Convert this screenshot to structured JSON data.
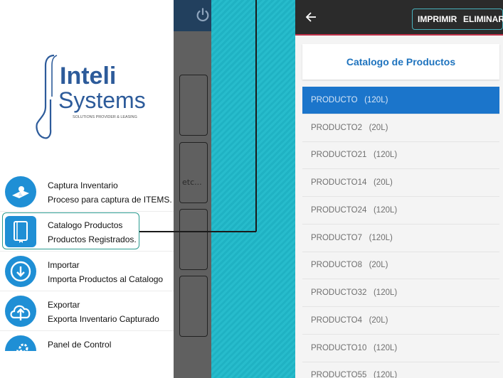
{
  "drawer": {
    "logo": {
      "brand_top": "Inteli",
      "brand_bottom": "Systems",
      "tagline": "SOLUTIONS PROVIDER & LEASING"
    },
    "menu": [
      {
        "title": "Captura Inventario",
        "subtitle": "Proceso para captura de ITEMS.",
        "icon": "inventory-capture-icon"
      },
      {
        "title": "Catalogo Productos",
        "subtitle": "Productos Registrados.",
        "icon": "catalog-book-icon"
      },
      {
        "title": "Importar",
        "subtitle": "Importa Productos al Catalogo",
        "icon": "download-icon"
      },
      {
        "title": "Exportar",
        "subtitle": "Exporta Inventario Capturado",
        "icon": "cloud-upload-icon"
      },
      {
        "title": "Panel de Control",
        "subtitle": "",
        "icon": "gears-icon"
      }
    ]
  },
  "behind": {
    "snippet": "etc..."
  },
  "catalog": {
    "actions": {
      "print": "IMPRIMIR",
      "delete": "ELIMINAR"
    },
    "title": "Catalogo de Productos",
    "products": [
      "PRODUCTO   (120L)",
      "PRODUCTO2   (20L)",
      "PRODUCTO21   (120L)",
      "PRODUCTO14   (20L)",
      "PRODUCTO24   (120L)",
      "PRODUCTO7   (120L)",
      "PRODUCTO8   (20L)",
      "PRODUCTO32   (120L)",
      "PRODUCTO4   (20L)",
      "PRODUCTO10   (120L)",
      "PRODUCTO55   (120L)"
    ]
  },
  "colors": {
    "accent": "#1b75cb",
    "teal": "#20b3c4",
    "appbar": "#2b2b2b",
    "appbar_border": "#c0324a"
  }
}
